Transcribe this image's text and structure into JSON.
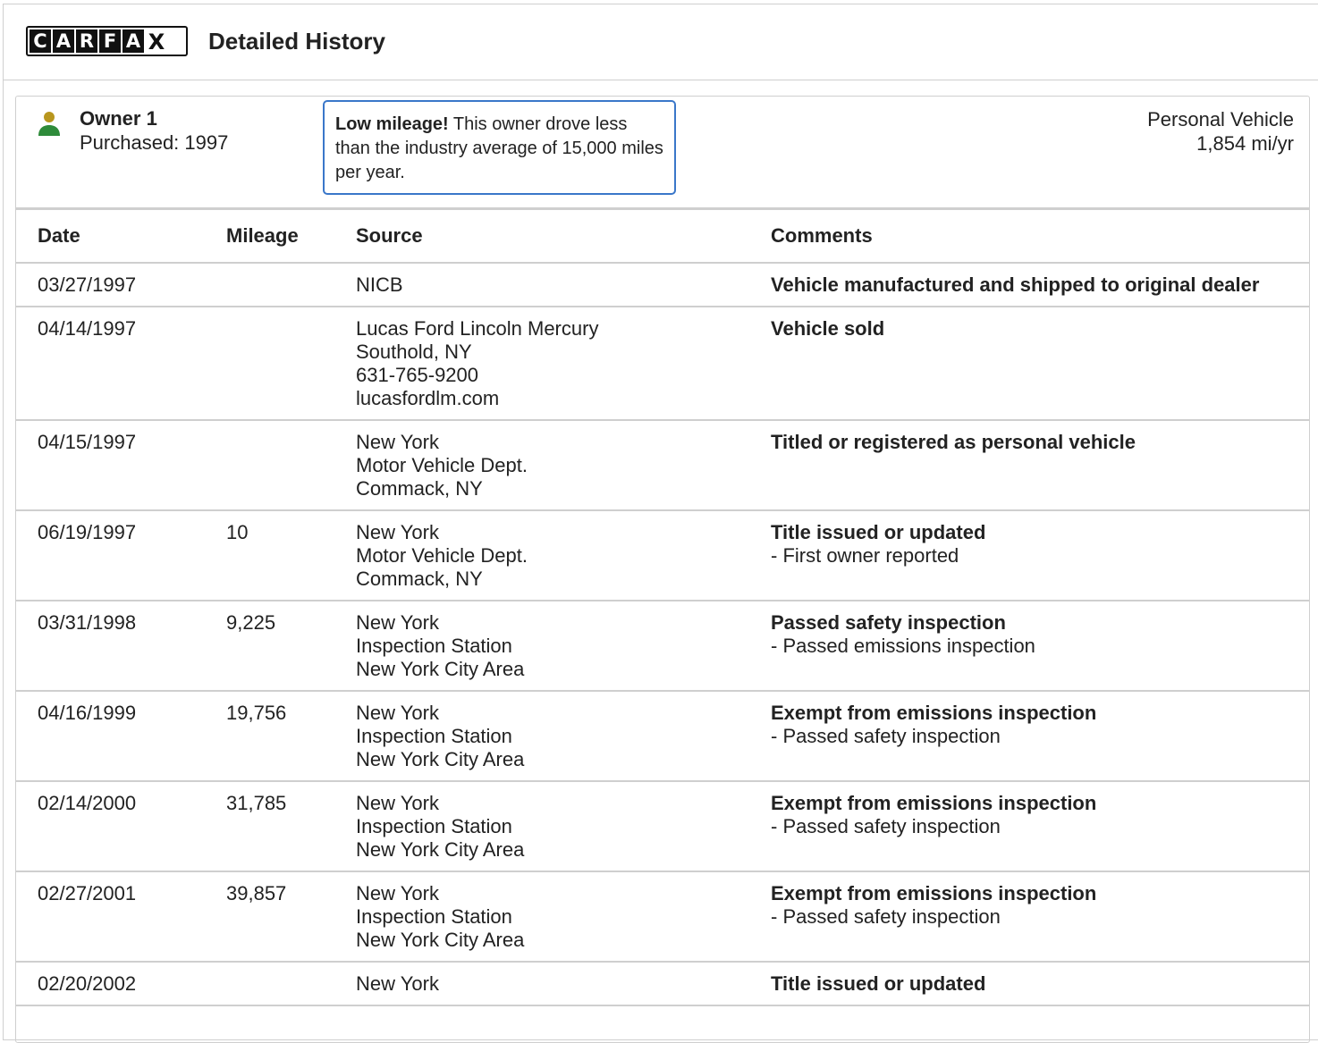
{
  "header": {
    "logo_letters": [
      "C",
      "A",
      "R",
      "F",
      "A",
      "X"
    ],
    "title": "Detailed History"
  },
  "owner": {
    "name": "Owner 1",
    "purchased": "Purchased: 1997",
    "callout_bold": "Low mileage!",
    "callout_text": " This owner drove less than the industry average of 15,000 miles per year.",
    "vehicle_type": "Personal Vehicle",
    "mileage_rate": "1,854 mi/yr",
    "icon_colors": {
      "head": "#b8961e",
      "body": "#2e8b3a"
    }
  },
  "table": {
    "columns": [
      "Date",
      "Mileage",
      "Source",
      "Comments"
    ],
    "rows": [
      {
        "date": "03/27/1997",
        "mileage": "",
        "source": [
          "NICB"
        ],
        "comment_title": "Vehicle manufactured and shipped to original dealer",
        "comment_detail": ""
      },
      {
        "date": "04/14/1997",
        "mileage": "",
        "source": [
          "Lucas Ford Lincoln Mercury",
          "Southold, NY",
          "631-765-9200",
          "lucasfordlm.com"
        ],
        "comment_title": "Vehicle sold",
        "comment_detail": ""
      },
      {
        "date": "04/15/1997",
        "mileage": "",
        "source": [
          "New York",
          "Motor Vehicle Dept.",
          "Commack, NY"
        ],
        "comment_title": "Titled or registered as personal vehicle",
        "comment_detail": ""
      },
      {
        "date": "06/19/1997",
        "mileage": "10",
        "source": [
          "New York",
          "Motor Vehicle Dept.",
          "Commack, NY"
        ],
        "comment_title": "Title issued or updated",
        "comment_detail": "- First owner reported"
      },
      {
        "date": "03/31/1998",
        "mileage": "9,225",
        "source": [
          "New York",
          "Inspection Station",
          "New York City Area"
        ],
        "comment_title": "Passed safety inspection",
        "comment_detail": "- Passed emissions inspection"
      },
      {
        "date": "04/16/1999",
        "mileage": "19,756",
        "source": [
          "New York",
          "Inspection Station",
          "New York City Area"
        ],
        "comment_title": "Exempt from emissions inspection",
        "comment_detail": "- Passed safety inspection"
      },
      {
        "date": "02/14/2000",
        "mileage": "31,785",
        "source": [
          "New York",
          "Inspection Station",
          "New York City Area"
        ],
        "comment_title": "Exempt from emissions inspection",
        "comment_detail": "- Passed safety inspection"
      },
      {
        "date": "02/27/2001",
        "mileage": "39,857",
        "source": [
          "New York",
          "Inspection Station",
          "New York City Area"
        ],
        "comment_title": "Exempt from emissions inspection",
        "comment_detail": "- Passed safety inspection"
      },
      {
        "date": "02/20/2002",
        "mileage": "",
        "source": [
          "New York"
        ],
        "comment_title": "Title issued or updated",
        "comment_detail": ""
      }
    ]
  }
}
